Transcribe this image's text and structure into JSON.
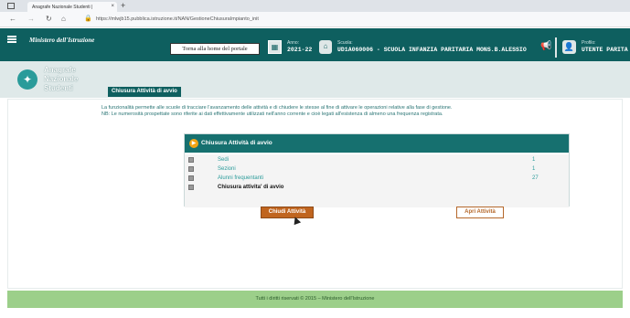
{
  "browser": {
    "tab_title": "Anagrafe Nazionale Studenti |",
    "tab_close": "×",
    "new_tab": "+",
    "url": "https://mlwjb15.pubblica.istruzione.it/NAN/GestioneChiusuraImpianto_init"
  },
  "header": {
    "ministry": "Ministero dell'Istruzione",
    "home_button": "Torna alla home del portale",
    "anno_label": "Anno:",
    "anno_value": "2021-22",
    "scuola_label": "Scuola:",
    "scuola_value": "UD1A060006 - SCUOLA INFANZIA PARITARIA MONS.B.ALESSIO",
    "profilo_label": "Profilo:",
    "profilo_value": "UTENTE PARITA"
  },
  "app": {
    "logo_line1": "Anagrafe",
    "logo_line2": "Nazionale",
    "logo_line3": "Studenti",
    "page_tab": "Chiusura Attività di avvio"
  },
  "info": {
    "line1": "La funzionalità permette alle scuole di tracciare l'avanzamento delle attività e di chiudere le stesse al fine di attivare le operazioni relative alla fase di gestione.",
    "line2": "NB: Le numerosità prospettate sono riferite ai dati effettivamente utilizzati nell'anno corrente e cioè legati all'esistenza di almeno una frequenza registrata."
  },
  "panel": {
    "title": "Chiusura Attività di avvio",
    "rows": [
      {
        "label": "Sedi",
        "value": "1"
      },
      {
        "label": "Sezioni",
        "value": "1"
      },
      {
        "label": "Alunni frequentanti",
        "value": "27"
      },
      {
        "label": "Chiusura attivita' di avvio",
        "value": ""
      }
    ]
  },
  "buttons": {
    "close": "Chiudi Attività",
    "open": "Apri Attività"
  },
  "footer": {
    "text": "Tutti i diritti riservati © 2015 – Ministero dell'Istruzione"
  },
  "colors": {
    "header_teal": "#0e5f5f",
    "panel_teal": "#16706f",
    "accent_orange": "#c0651f",
    "footer_green": "#9ccf8a"
  }
}
